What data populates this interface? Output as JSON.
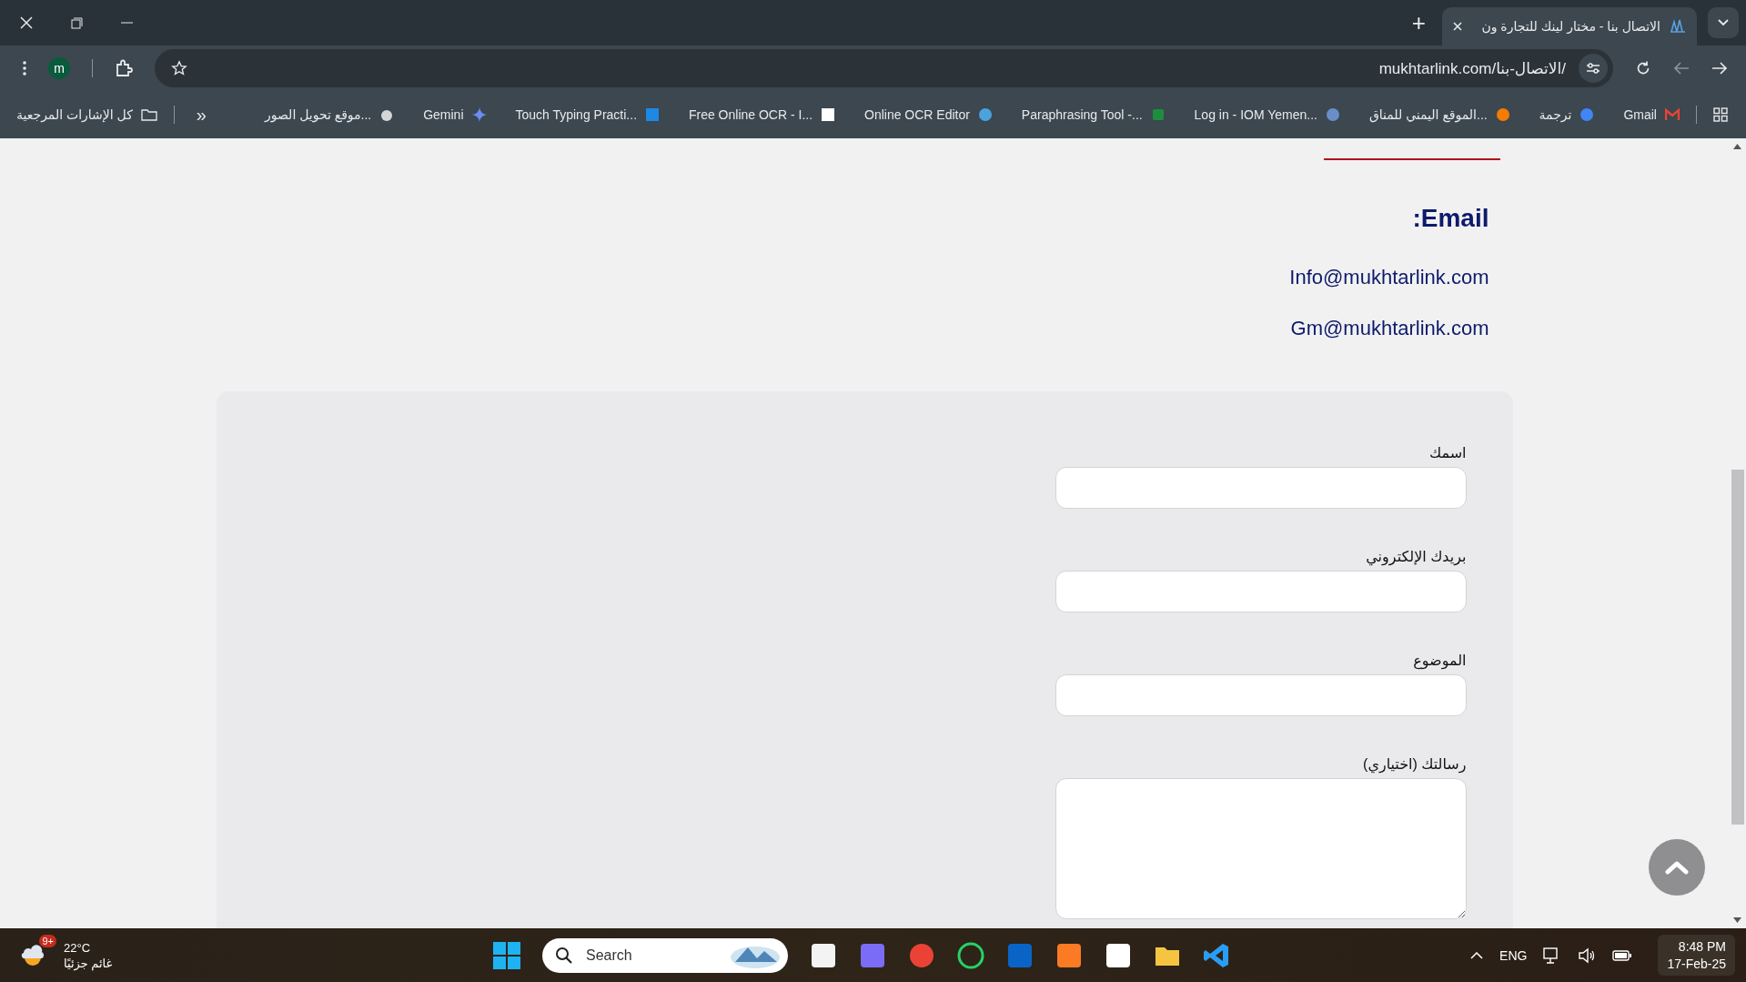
{
  "browser": {
    "tabs": [
      {
        "title": "الاتصال بنا - مختار لينك للتجارة ون",
        "selected": true
      }
    ],
    "new_tab": "+",
    "profile": "m",
    "address": "mukhtarlink.com/الاتصال-بنا/",
    "bookmarks": [
      {
        "label": "Gmail"
      },
      {
        "label": "ترجمة"
      },
      {
        "label": "الموقع اليمني للمناق..."
      },
      {
        "label": "Log in - IOM Yemen..."
      },
      {
        "label": "Paraphrasing Tool -..."
      },
      {
        "label": "Online OCR Editor"
      },
      {
        "label": "Free Online OCR - I..."
      },
      {
        "label": "Touch Typing Practi..."
      },
      {
        "label": "Gemini"
      },
      {
        "label": "موقع تحويل الصور..."
      }
    ],
    "more_bookmarks": "»",
    "all_bookmarks": "كل الإشارات المرجعية"
  },
  "page": {
    "email_heading": ":Email",
    "emails": [
      "Info@mukhtarlink.com",
      "Gm@mukhtarlink.com"
    ],
    "form": {
      "fields": [
        {
          "label": "اسمك",
          "kind": "input"
        },
        {
          "label": "بريدك الإلكتروني",
          "kind": "input"
        },
        {
          "label": "الموضوع",
          "kind": "input"
        },
        {
          "label": "رسالتك (اختياري)",
          "kind": "textarea"
        }
      ]
    }
  },
  "taskbar": {
    "weather": {
      "temperature": "22°C",
      "condition": "غائم جزئيًا",
      "badge": "9+"
    },
    "search": {
      "placeholder": "Search"
    },
    "language": "ENG",
    "time": "8:48 PM",
    "date": "17-Feb-25"
  }
}
